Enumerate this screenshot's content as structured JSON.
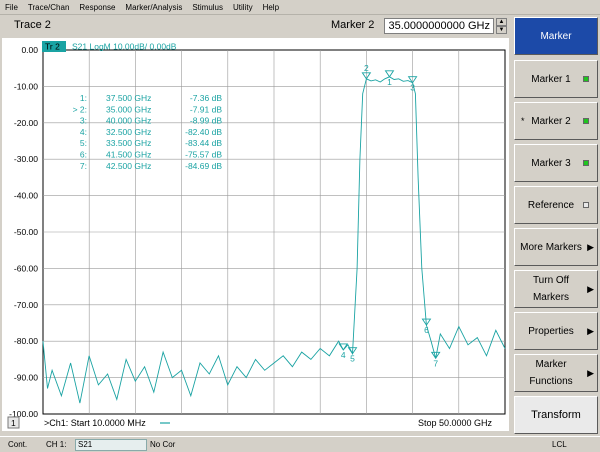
{
  "menu": [
    "File",
    "Trace/Chan",
    "Response",
    "Marker/Analysis",
    "Stimulus",
    "Utility",
    "Help"
  ],
  "header": {
    "trace_label": "Trace 2",
    "marker_label": "Marker 2",
    "marker_value": "35.0000000000 GHz"
  },
  "trace_tag": {
    "tr": "Tr 2",
    "desc": "S21 LogM 10.00dB/  0.00dB"
  },
  "channel_num": "1",
  "start_text": ">Ch1: Start  10.0000 MHz",
  "stop_text": "Stop  50.0000 GHz",
  "marker_table": [
    {
      "id": "1:",
      "freq": "37.500 GHz",
      "val": "-7.36 dB"
    },
    {
      "id": "> 2:",
      "freq": "35.000 GHz",
      "val": "-7.91 dB"
    },
    {
      "id": "3:",
      "freq": "40.000 GHz",
      "val": "-8.99 dB"
    },
    {
      "id": "4:",
      "freq": "32.500 GHz",
      "val": "-82.40 dB"
    },
    {
      "id": "5:",
      "freq": "33.500 GHz",
      "val": "-83.44 dB"
    },
    {
      "id": "6:",
      "freq": "41.500 GHz",
      "val": "-75.57 dB"
    },
    {
      "id": "7:",
      "freq": "42.500 GHz",
      "val": "-84.69 dB"
    }
  ],
  "softkeys": [
    {
      "label": "Marker",
      "active": true
    },
    {
      "label": "Marker 1",
      "indicator": "on"
    },
    {
      "label": "Marker 2",
      "indicator": "on",
      "star": "*"
    },
    {
      "label": "Marker 3",
      "indicator": "on"
    },
    {
      "label": "Reference",
      "indicator": "off"
    },
    {
      "label": "More Markers",
      "arrow": "▶"
    },
    {
      "label": "Turn Off Markers",
      "arrow": "▶"
    },
    {
      "label": "Properties",
      "arrow": "▶"
    },
    {
      "label": "Marker Functions",
      "arrow": "▶"
    },
    {
      "label": "Transform"
    }
  ],
  "status": {
    "mode": "Cont.",
    "channel": "CH 1:",
    "param": "S21",
    "correction": "No Cor",
    "remote": "LCL"
  },
  "colors": {
    "trace": "#1aa3a3",
    "grid": "#9a9a9a",
    "active_key": "#1c4aa8"
  },
  "chart_data": {
    "type": "line",
    "xlim": [
      0.01,
      50
    ],
    "x_unit": "GHz",
    "ylim": [
      -100,
      0
    ],
    "y_ticks": [
      "0.00",
      "-10.00",
      "-20.00",
      "-30.00",
      "-40.00",
      "-50.00",
      "-60.00",
      "-70.00",
      "-80.00",
      "-90.00",
      "-100.00"
    ],
    "grid": true,
    "series": [
      {
        "x": [
          0.01,
          0.5,
          1,
          2,
          3,
          4,
          5,
          6,
          7,
          8,
          9,
          10,
          11,
          12,
          13,
          14,
          15,
          16,
          17,
          18,
          19,
          20,
          21,
          22,
          23,
          24,
          25,
          26,
          27,
          28,
          29,
          30,
          31,
          32,
          32.5,
          33,
          33.5,
          34,
          34.3,
          34.6,
          35,
          35.5,
          36,
          36.5,
          37,
          37.5,
          38,
          38.5,
          39,
          39.5,
          40,
          40.3,
          40.6,
          41,
          41.5,
          42,
          42.5,
          43,
          44,
          45,
          46,
          47,
          48,
          49,
          50
        ],
        "y": [
          -80,
          -93,
          -88,
          -95,
          -86,
          -97,
          -84,
          -92,
          -89,
          -96,
          -85,
          -91,
          -87,
          -94,
          -83,
          -90,
          -88,
          -95,
          -86,
          -89,
          -84,
          -92,
          -87,
          -90,
          -85,
          -88,
          -86,
          -84,
          -87,
          -83,
          -85,
          -82,
          -84,
          -80,
          -82.4,
          -81,
          -83.4,
          -60,
          -30,
          -12,
          -7.91,
          -8.5,
          -8.2,
          -8.8,
          -7.9,
          -7.36,
          -8.1,
          -7.9,
          -8.6,
          -8.4,
          -8.99,
          -12,
          -35,
          -60,
          -75.57,
          -80,
          -84.69,
          -78,
          -82,
          -76,
          -81,
          -79,
          -84,
          -77,
          -82
        ]
      }
    ],
    "markers": [
      {
        "label": "1",
        "x": 37.5,
        "y": -7.36
      },
      {
        "label": "2",
        "x": 35.0,
        "y": -7.91
      },
      {
        "label": "3",
        "x": 40.0,
        "y": -8.99
      },
      {
        "label": "4",
        "x": 32.5,
        "y": -82.4
      },
      {
        "label": "5",
        "x": 33.5,
        "y": -83.44
      },
      {
        "label": "6",
        "x": 41.5,
        "y": -75.57
      },
      {
        "label": "7",
        "x": 42.5,
        "y": -84.69
      }
    ]
  }
}
